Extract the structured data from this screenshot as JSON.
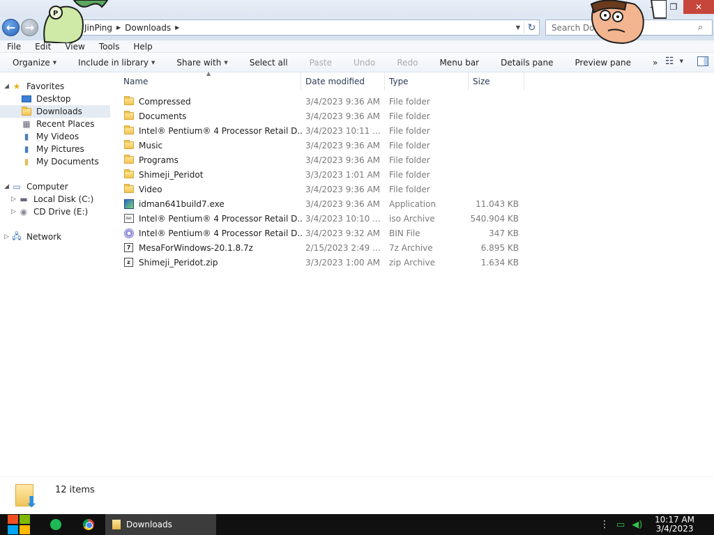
{
  "window": {
    "controls": {
      "minimize": "—",
      "maximize": "❐",
      "close": "✕"
    }
  },
  "address": {
    "breadcrumbs": [
      "JinPing",
      "Downloads"
    ],
    "search_placeholder": "Search Do"
  },
  "menu": [
    "File",
    "Edit",
    "View",
    "Tools",
    "Help"
  ],
  "toolbar": {
    "organize": "Organize",
    "include_in_library": "Include in library",
    "share_with": "Share with",
    "select_all": "Select all",
    "paste": "Paste",
    "undo": "Undo",
    "redo": "Redo",
    "menu_bar": "Menu bar",
    "details_pane": "Details pane",
    "preview_pane": "Preview pane",
    "more": "»"
  },
  "nav": {
    "favorites": "Favorites",
    "desktop": "Desktop",
    "downloads": "Downloads",
    "recent_places": "Recent Places",
    "my_videos": "My Videos",
    "my_pictures": "My Pictures",
    "my_documents": "My Documents",
    "computer": "Computer",
    "local_disk": "Local Disk (C:)",
    "cd_drive": "CD Drive (E:)",
    "network": "Network"
  },
  "columns": {
    "name": "Name",
    "date_modified": "Date modified",
    "type": "Type",
    "size": "Size"
  },
  "files": [
    {
      "name": "Compressed",
      "date": "3/4/2023 9:36 AM",
      "type": "File folder",
      "size": "",
      "icon": "folder"
    },
    {
      "name": "Documents",
      "date": "3/4/2023 9:36 AM",
      "type": "File folder",
      "size": "",
      "icon": "folder"
    },
    {
      "name": "Intel® Pentium® 4 Processor Retail D...",
      "date": "3/4/2023 10:11 ...",
      "type": "File folder",
      "size": "",
      "icon": "folder"
    },
    {
      "name": "Music",
      "date": "3/4/2023 9:36 AM",
      "type": "File folder",
      "size": "",
      "icon": "folder"
    },
    {
      "name": "Programs",
      "date": "3/4/2023 9:36 AM",
      "type": "File folder",
      "size": "",
      "icon": "folder"
    },
    {
      "name": "Shimeji_Peridot",
      "date": "3/3/2023 1:01 AM",
      "type": "File folder",
      "size": "",
      "icon": "folder"
    },
    {
      "name": "Video",
      "date": "3/4/2023 9:36 AM",
      "type": "File folder",
      "size": "",
      "icon": "folder"
    },
    {
      "name": "idman641build7.exe",
      "date": "3/4/2023 9:36 AM",
      "type": "Application",
      "size": "11.043 KB",
      "icon": "app"
    },
    {
      "name": "Intel® Pentium® 4 Processor Retail D...",
      "date": "3/4/2023 10:10 ...",
      "type": "iso Archive",
      "size": "540.904 KB",
      "icon": "iso"
    },
    {
      "name": "Intel® Pentium® 4 Processor Retail D...",
      "date": "3/4/2023 9:32 AM",
      "type": "BIN File",
      "size": "347 KB",
      "icon": "bin"
    },
    {
      "name": "MesaForWindows-20.1.8.7z",
      "date": "2/15/2023 2:49 ...",
      "type": "7z Archive",
      "size": "6.895 KB",
      "icon": "7z"
    },
    {
      "name": "Shimeji_Peridot.zip",
      "date": "3/3/2023 1:00 AM",
      "type": "zip Archive",
      "size": "1.634 KB",
      "icon": "zip"
    }
  ],
  "status": {
    "items_count": "12 items"
  },
  "taskbar": {
    "active_task": "Downloads",
    "time": "10:17 AM",
    "date": "3/4/2023"
  }
}
